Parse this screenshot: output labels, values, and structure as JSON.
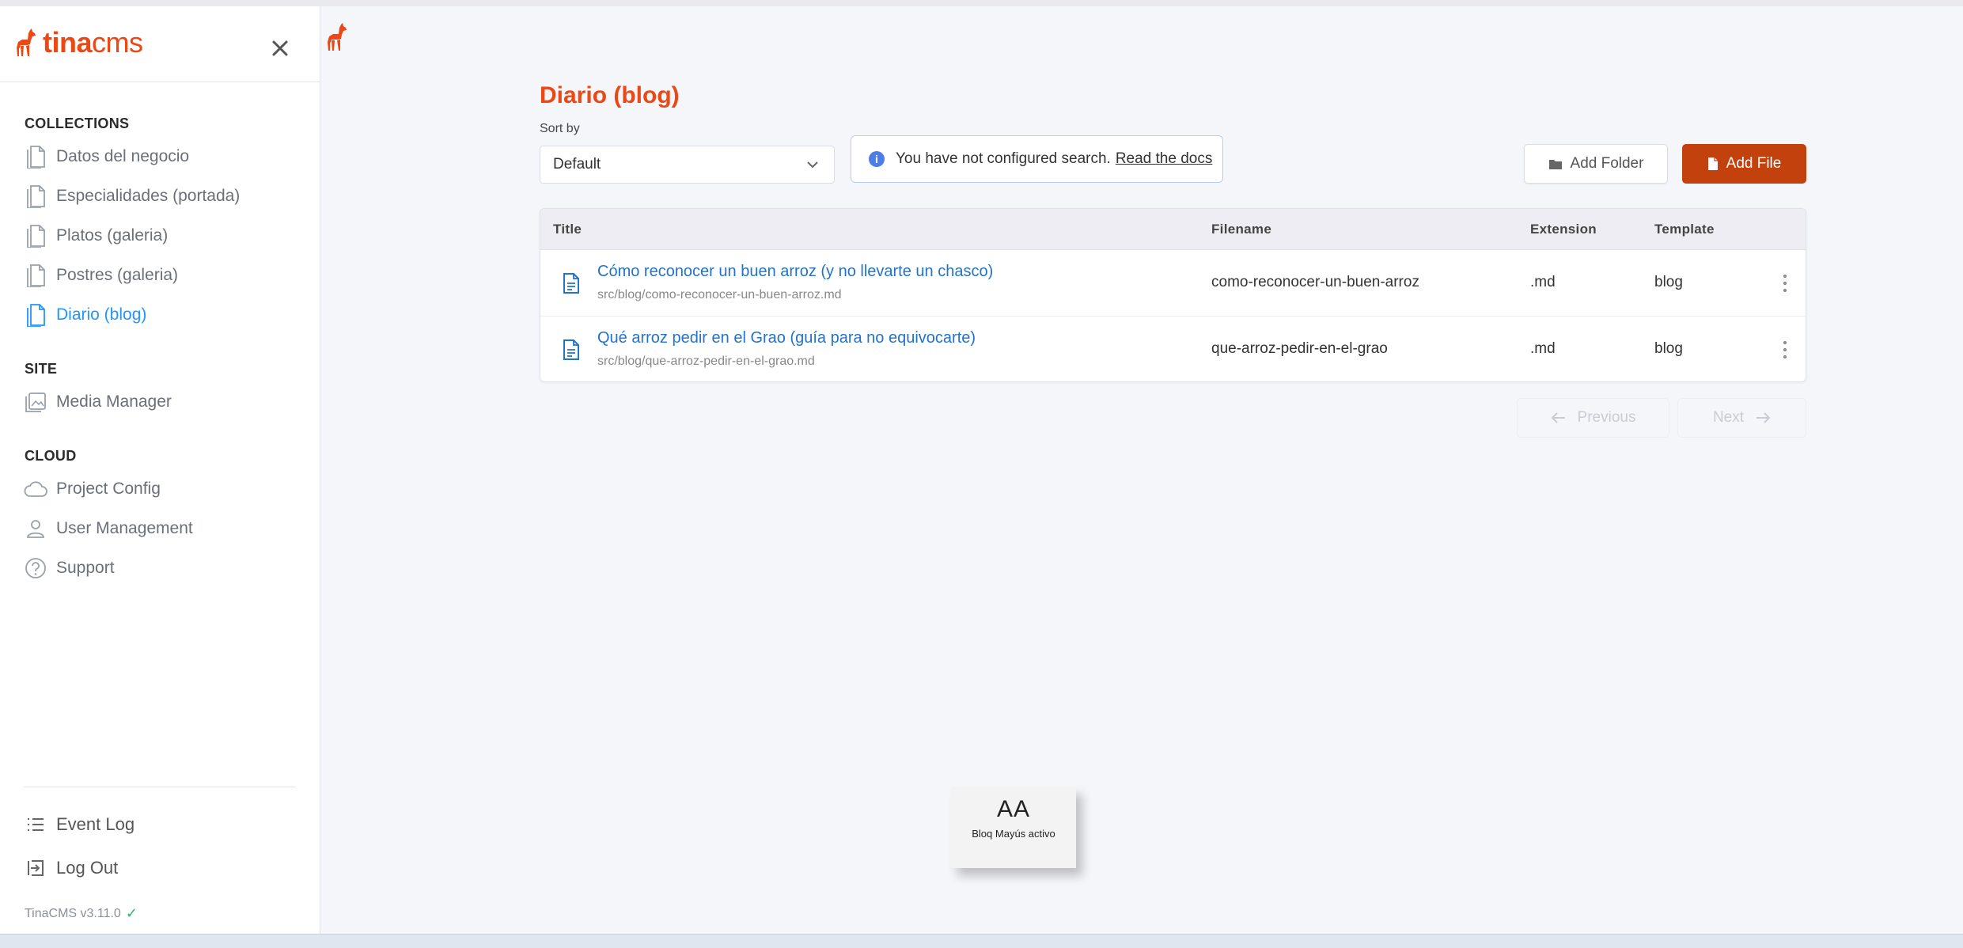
{
  "app": {
    "name": "tinacms",
    "name_bold": "tina",
    "name_light": "cms",
    "version": "TinaCMS v3.11.0"
  },
  "sidebar": {
    "sections": [
      {
        "label": "COLLECTIONS"
      },
      {
        "label": "SITE"
      },
      {
        "label": "CLOUD"
      }
    ],
    "collections": [
      {
        "label": "Datos del negocio",
        "icon": "document-icon"
      },
      {
        "label": "Especialidades (portada)",
        "icon": "document-icon"
      },
      {
        "label": "Platos (galeria)",
        "icon": "document-icon"
      },
      {
        "label": "Postres (galeria)",
        "icon": "document-icon"
      },
      {
        "label": "Diario (blog)",
        "icon": "document-icon",
        "active": true
      }
    ],
    "site": [
      {
        "label": "Media Manager",
        "icon": "image-icon"
      }
    ],
    "cloud": [
      {
        "label": "Project Config",
        "icon": "cloud-icon"
      },
      {
        "label": "User Management",
        "icon": "user-icon"
      },
      {
        "label": "Support",
        "icon": "help-icon"
      }
    ],
    "bottom": [
      {
        "label": "Event Log",
        "icon": "list-icon"
      },
      {
        "label": "Log Out",
        "icon": "logout-icon"
      }
    ]
  },
  "main": {
    "title": "Diario (blog)",
    "sort": {
      "label": "Sort by",
      "value": "Default"
    },
    "search_notice": {
      "text": "You have not configured search.",
      "link": "Read the docs"
    },
    "buttons": {
      "add_folder": "Add Folder",
      "add_file": "Add File"
    },
    "table": {
      "columns": [
        "Title",
        "Filename",
        "Extension",
        "Template"
      ],
      "rows": [
        {
          "title": "Cómo reconocer un buen arroz (y no llevarte un chasco)",
          "path": "src/blog/como-reconocer-un-buen-arroz.md",
          "filename": "como-reconocer-un-buen-arroz",
          "extension": ".md",
          "template": "blog"
        },
        {
          "title": "Qué arroz pedir en el Grao (guía para no equivocarte)",
          "path": "src/blog/que-arroz-pedir-en-el-grao.md",
          "filename": "que-arroz-pedir-en-el-grao",
          "extension": ".md",
          "template": "blog"
        }
      ]
    },
    "pagination": {
      "previous": "Previous",
      "next": "Next"
    }
  },
  "caps_lock_toast": {
    "glyph": "AA",
    "message": "Bloq Mayús activo"
  },
  "colors": {
    "brand": "#ec4815",
    "primary_button": "#c2410c",
    "active_link": "#2296fe",
    "row_link": "#2273c9"
  }
}
